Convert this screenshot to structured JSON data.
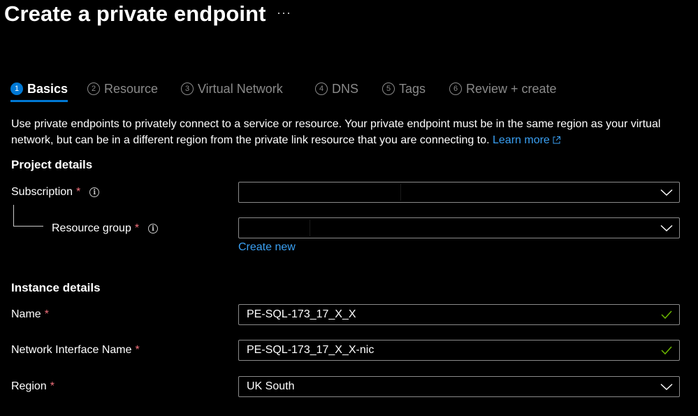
{
  "page": {
    "title": "Create a private endpoint",
    "more_label": "···"
  },
  "tabs": [
    {
      "num": "1",
      "label": "Basics",
      "active": true
    },
    {
      "num": "2",
      "label": "Resource",
      "active": false
    },
    {
      "num": "3",
      "label": "Virtual Network",
      "active": false
    },
    {
      "num": "4",
      "label": "DNS",
      "active": false
    },
    {
      "num": "5",
      "label": "Tags",
      "active": false
    },
    {
      "num": "6",
      "label": "Review + create",
      "active": false
    }
  ],
  "description": {
    "text": "Use private endpoints to privately connect to a service or resource. Your private endpoint must be in the same region as your virtual network, but can be in a different region from the private link resource that you are connecting to.",
    "link": "Learn more"
  },
  "project_details": {
    "heading": "Project details",
    "subscription": {
      "label": "Subscription",
      "required": "*",
      "value": ""
    },
    "resource_group": {
      "label": "Resource group",
      "required": "*",
      "value": "",
      "create_new": "Create new"
    }
  },
  "instance_details": {
    "heading": "Instance details",
    "name": {
      "label": "Name",
      "required": "*",
      "value": "PE-SQL-173_17_X_X"
    },
    "nic_name": {
      "label": "Network Interface Name",
      "required": "*",
      "value": "PE-SQL-173_17_X_X-nic"
    },
    "region": {
      "label": "Region",
      "required": "*",
      "value": "UK South"
    }
  },
  "icons": {
    "info": "info-icon",
    "chevron": "chevron-down-icon",
    "check": "checkmark-icon",
    "external": "external-link-icon"
  },
  "colors": {
    "background": "#000000",
    "accent": "#0078d4",
    "link": "#3aa0f3",
    "required": "#f1707b",
    "valid": "#6bb700",
    "muted": "#8a8a8a"
  }
}
